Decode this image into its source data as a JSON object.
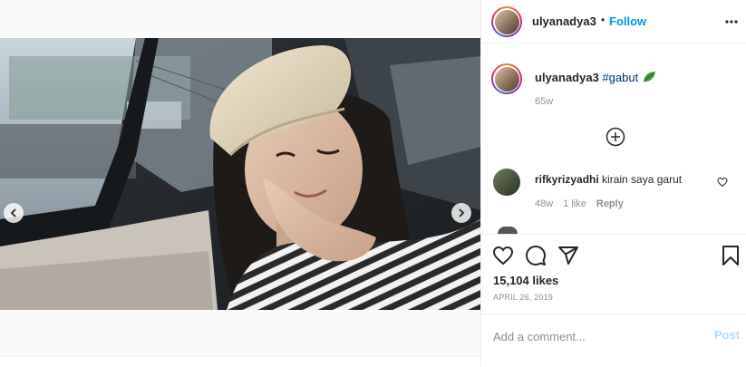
{
  "post": {
    "username": "ulyanadya3",
    "follow_separator": "•",
    "follow_label": "Follow",
    "more_icon": "more-horizontal-icon"
  },
  "caption": {
    "username": "ulyanadya3",
    "text": "#gabut",
    "emoji": "leaf",
    "age": "65w"
  },
  "load_more": {
    "icon": "plus-circle-icon"
  },
  "comments": [
    {
      "username": "rifkyrizyadhi",
      "text": "kirain saya garut",
      "age": "48w",
      "likes": "1 like",
      "reply_label": "Reply"
    }
  ],
  "actions": {
    "like_icon": "heart-icon",
    "comment_icon": "comment-icon",
    "share_icon": "send-icon",
    "save_icon": "bookmark-icon"
  },
  "likes_label": "15,104 likes",
  "date": "APRIL 26, 2019",
  "comment_input": {
    "placeholder": "Add a comment...",
    "post_label": "Post"
  },
  "carousel": {
    "slide_count": 5,
    "active_index": 1
  },
  "colors": {
    "accent": "#0095f6",
    "post_disabled": "#b2dffc",
    "text": "#262626",
    "muted": "#8e8e8e"
  }
}
